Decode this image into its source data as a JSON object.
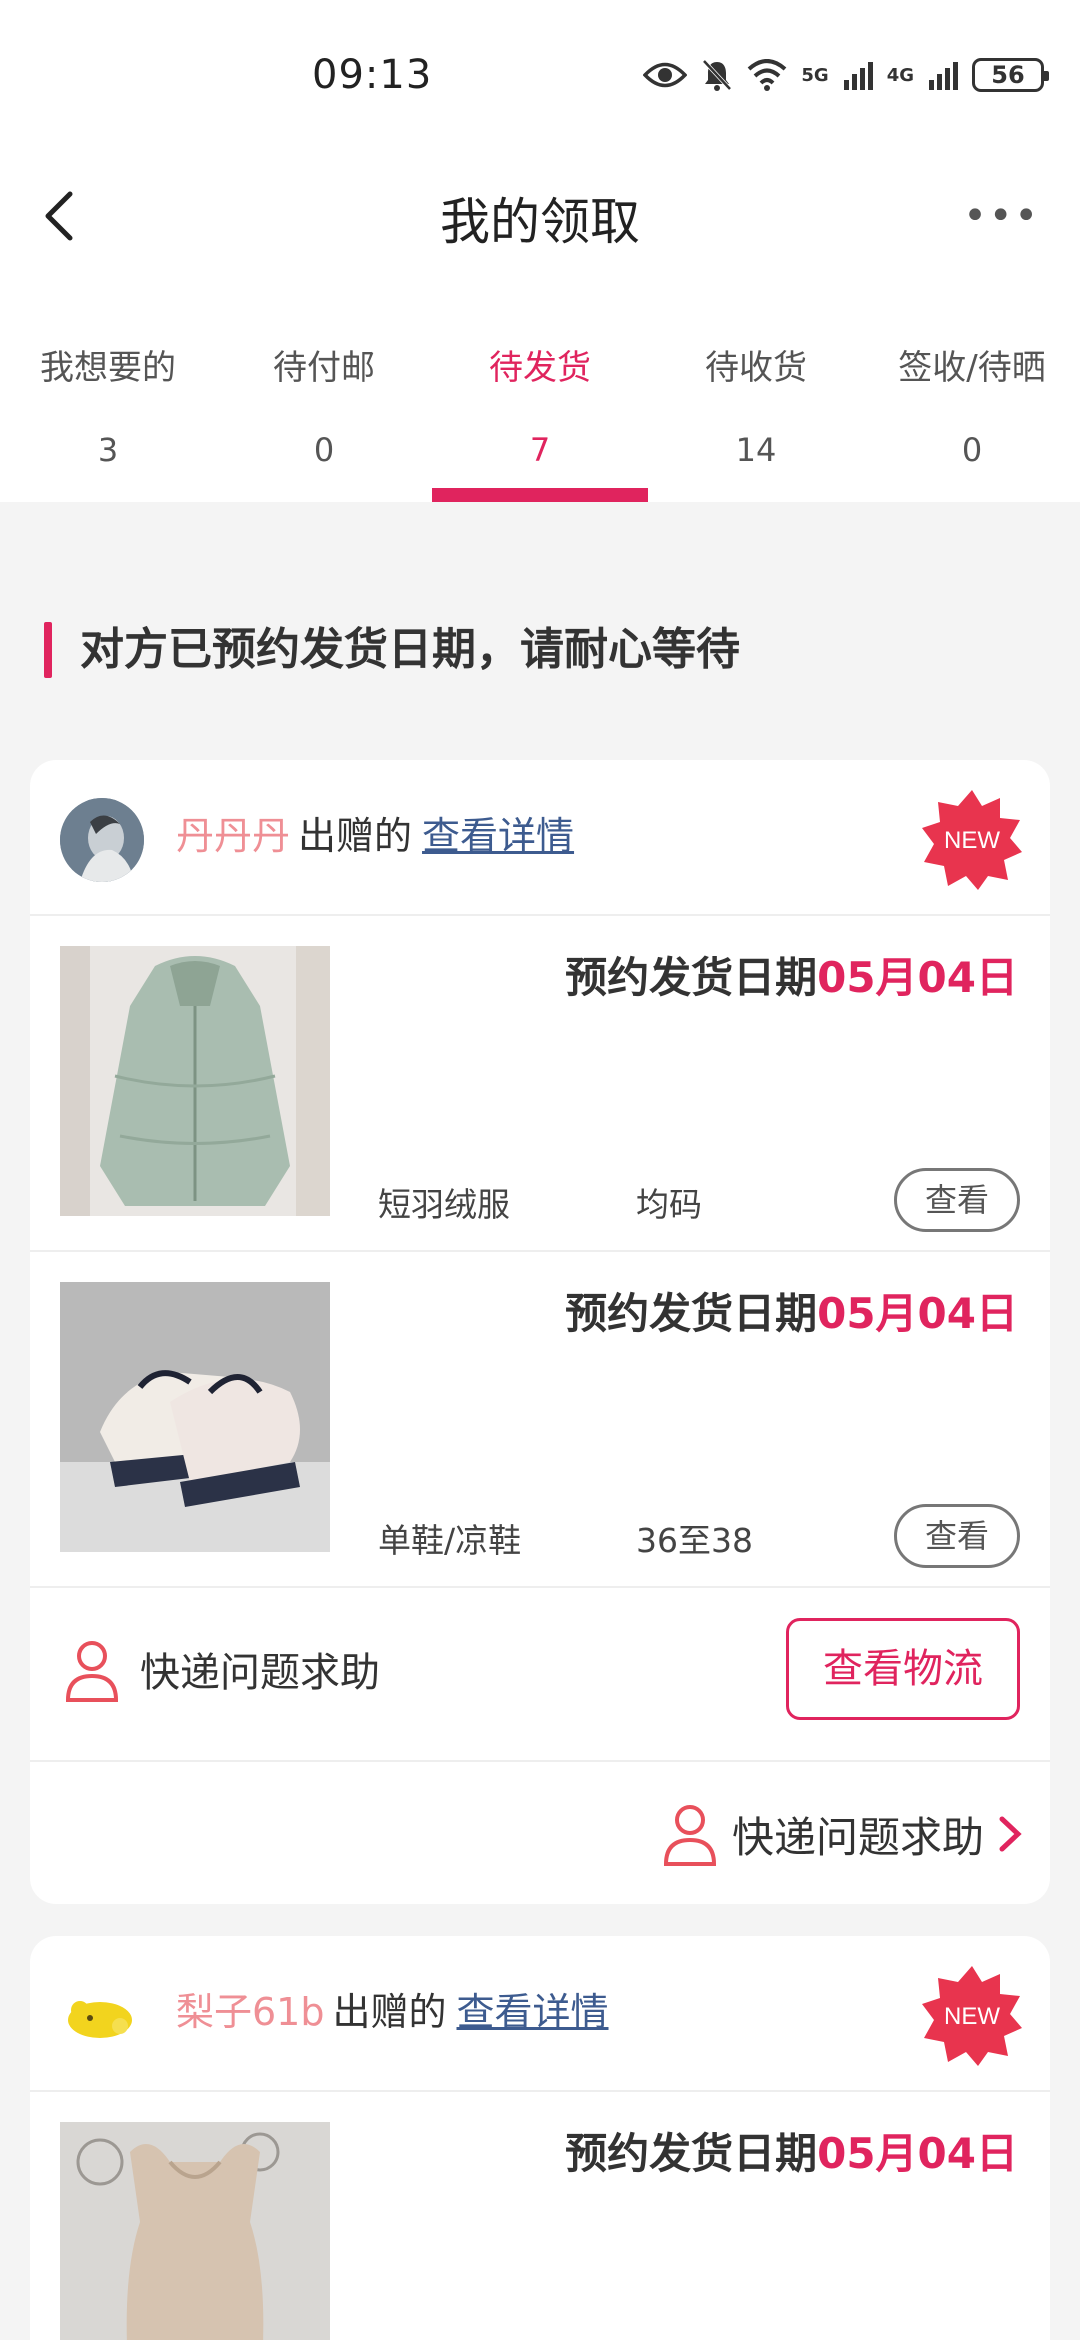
{
  "status_bar": {
    "time": "09:13",
    "battery": "56",
    "sig1": "5G",
    "sig2": "4G"
  },
  "header": {
    "title": "我的领取",
    "more": "•••"
  },
  "tabs": [
    {
      "label": "我想要的",
      "count": "3"
    },
    {
      "label": "待付邮",
      "count": "0"
    },
    {
      "label": "待发货",
      "count": "7",
      "active": true
    },
    {
      "label": "待收货",
      "count": "14"
    },
    {
      "label": "签收/待晒",
      "count": "0"
    }
  ],
  "section": {
    "title": "对方已预约发货日期，请耐心等待"
  },
  "cards": [
    {
      "donor_name": "丹丹丹",
      "gift_text": "出赠的",
      "detail_link": "查看详情",
      "badge": "NEW",
      "items": [
        {
          "ship_label": "预约发货日期",
          "ship_date": "05月04日",
          "name": "短羽绒服",
          "size": "均码",
          "view_label": "查看"
        },
        {
          "ship_label": "预约发货日期",
          "ship_date": "05月04日",
          "name": "单鞋/凉鞋",
          "size": "36至38",
          "view_label": "查看"
        }
      ],
      "help_label": "快递问题求助",
      "logistics_label": "查看物流",
      "help_link": "快递问题求助"
    },
    {
      "donor_name": "梨子61b",
      "gift_text": "出赠的",
      "detail_link": "查看详情",
      "badge": "NEW",
      "items": [
        {
          "ship_label": "预约发货日期",
          "ship_date": "05月04日"
        }
      ]
    }
  ],
  "colors": {
    "accent": "#e0245e",
    "donor_name": "#ef8f95",
    "link": "#3d5b8f"
  }
}
